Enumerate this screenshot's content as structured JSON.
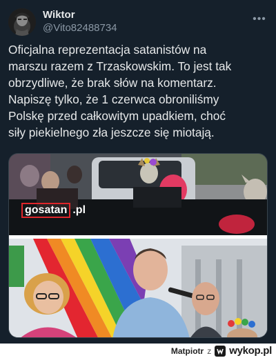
{
  "tweet": {
    "display_name": "Wiktor",
    "handle": "@Vito82488734",
    "more_label": "•••",
    "lines": [
      "Oficjalna reprezentacja satanistów na",
      "marszu razem z Trzaskowskim. To jest tak",
      "obrzydliwe, że brak słów na komentarz.",
      "Napiszę tylko, że 1 czerwca obroniliśmy",
      "Polskę przed całkowitym upadkiem, choć",
      "siły piekielnego zła jeszcze się miotają."
    ]
  },
  "media": {
    "watermark_name": "gosatan",
    "watermark_tld": ".pl"
  },
  "footer": {
    "user": "Matpiotr",
    "z": "z",
    "site": "wykop.pl"
  },
  "colors": {
    "background": "#15202b",
    "text": "#e7e9ea",
    "muted": "#8b98a5",
    "watermark_border": "#e0262b"
  }
}
